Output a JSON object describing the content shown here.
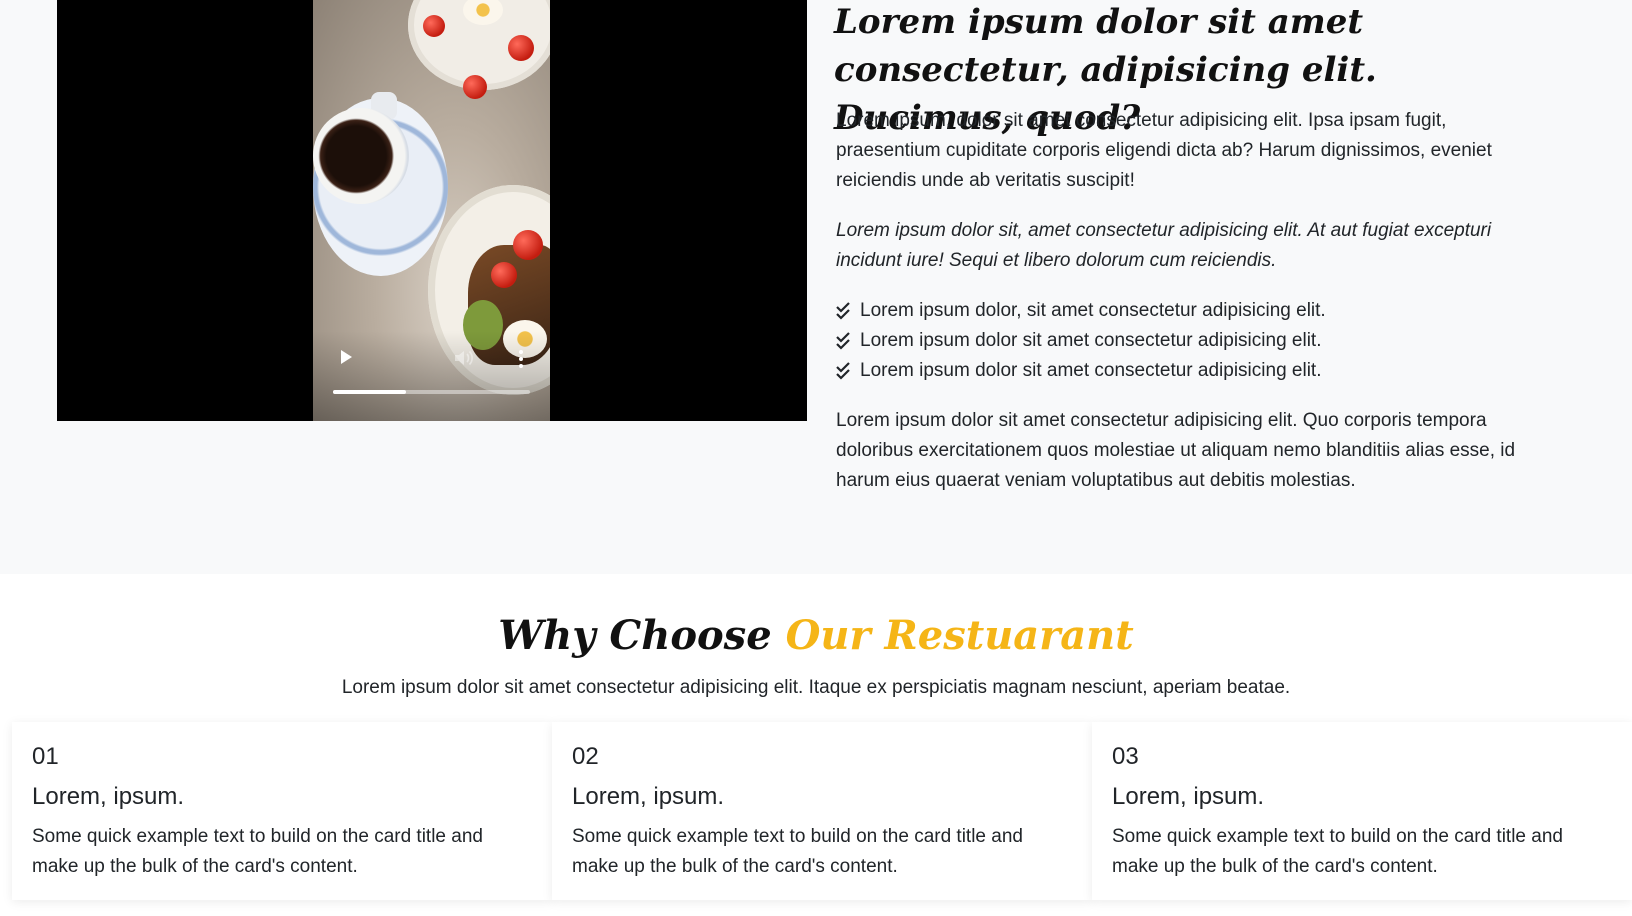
{
  "about": {
    "heading": "Lorem ipsum dolor sit amet consectetur, adipisicing elit. Ducimus, quod?",
    "paragraph1": "Lorem ipsum, dolor sit amet consectetur adipisicing elit. Ipsa ipsam fugit, praesentium cupiditate corporis eligendi dicta ab? Harum dignissimos, eveniet reiciendis unde ab veritatis suscipit!",
    "paragraph2": "Lorem ipsum dolor sit, amet consectetur adipisicing elit. At aut fugiat excepturi incidunt iure! Sequi et libero dolorum cum reiciendis.",
    "checklist": [
      "Lorem ipsum dolor, sit amet consectetur adipisicing elit.",
      "Lorem ipsum dolor sit amet consectetur adipisicing elit.",
      "Lorem ipsum dolor sit amet consectetur adipisicing elit."
    ],
    "paragraph3": "Lorem ipsum dolor sit amet consectetur adipisicing elit. Quo corporis tempora doloribus exercitationem quos molestiae ut aliquam nemo blanditiis alias esse, id harum eius quaerat veniam voluptatibus aut debitis molestias.",
    "video": {
      "play_icon": "play-icon",
      "volume_icon": "volume-icon",
      "more_icon": "more-vert-icon",
      "progress": 0.37
    }
  },
  "why": {
    "title_main": "Why Choose ",
    "title_accent": "Our Restuarant",
    "subtitle": "Lorem ipsum dolor sit amet consectetur adipisicing elit. Itaque ex perspiciatis magnam nesciunt, aperiam beatae.",
    "cards": [
      {
        "number": "01",
        "title": "Lorem, ipsum.",
        "text": "Some quick example text to build on the card title and make up the bulk of the card's content."
      },
      {
        "number": "02",
        "title": "Lorem, ipsum.",
        "text": "Some quick example text to build on the card title and make up the bulk of the card's content."
      },
      {
        "number": "03",
        "title": "Lorem, ipsum.",
        "text": "Some quick example text to build on the card title and make up the bulk of the card's content."
      }
    ]
  },
  "colors": {
    "accent": "#f5b517",
    "section_bg": "#f8f9fa",
    "text": "#212529"
  }
}
